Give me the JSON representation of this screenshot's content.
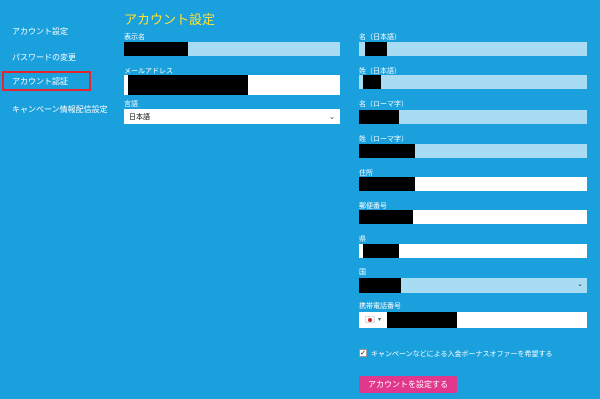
{
  "sidebar": {
    "items": [
      {
        "label": "アカウント設定"
      },
      {
        "label": "パスワードの変更"
      },
      {
        "label": "アカウント認証"
      },
      {
        "label": "キャンペーン情報配信設定"
      }
    ]
  },
  "main": {
    "title": "アカウント設定",
    "left": {
      "display_name_label": "表示名",
      "email_label": "メールアドレス",
      "language_label": "言語",
      "language_value": "日本語"
    },
    "right": {
      "first_name_jp_label": "名（日本語）",
      "last_name_jp_label": "姓（日本語）",
      "first_name_roman_label": "名（ローマ字）",
      "last_name_roman_label": "姓（ローマ字）",
      "address_label": "住所",
      "postal_label": "郵便番号",
      "city_label": "県",
      "country_label": "国",
      "phone_label": "携帯電話番号"
    },
    "bonus_checkbox_label": "キャンペーンなどによる入金ボーナスオファーを希望する",
    "bonus_checked": true,
    "submit_label": "アカウントを設定する"
  },
  "colors": {
    "background": "#1aa0dc",
    "title": "#ffe234",
    "highlight_border": "#e6262f",
    "submit": "#e1378c",
    "field_light": "#ffffff",
    "field_blue": "#a8dcf3"
  }
}
